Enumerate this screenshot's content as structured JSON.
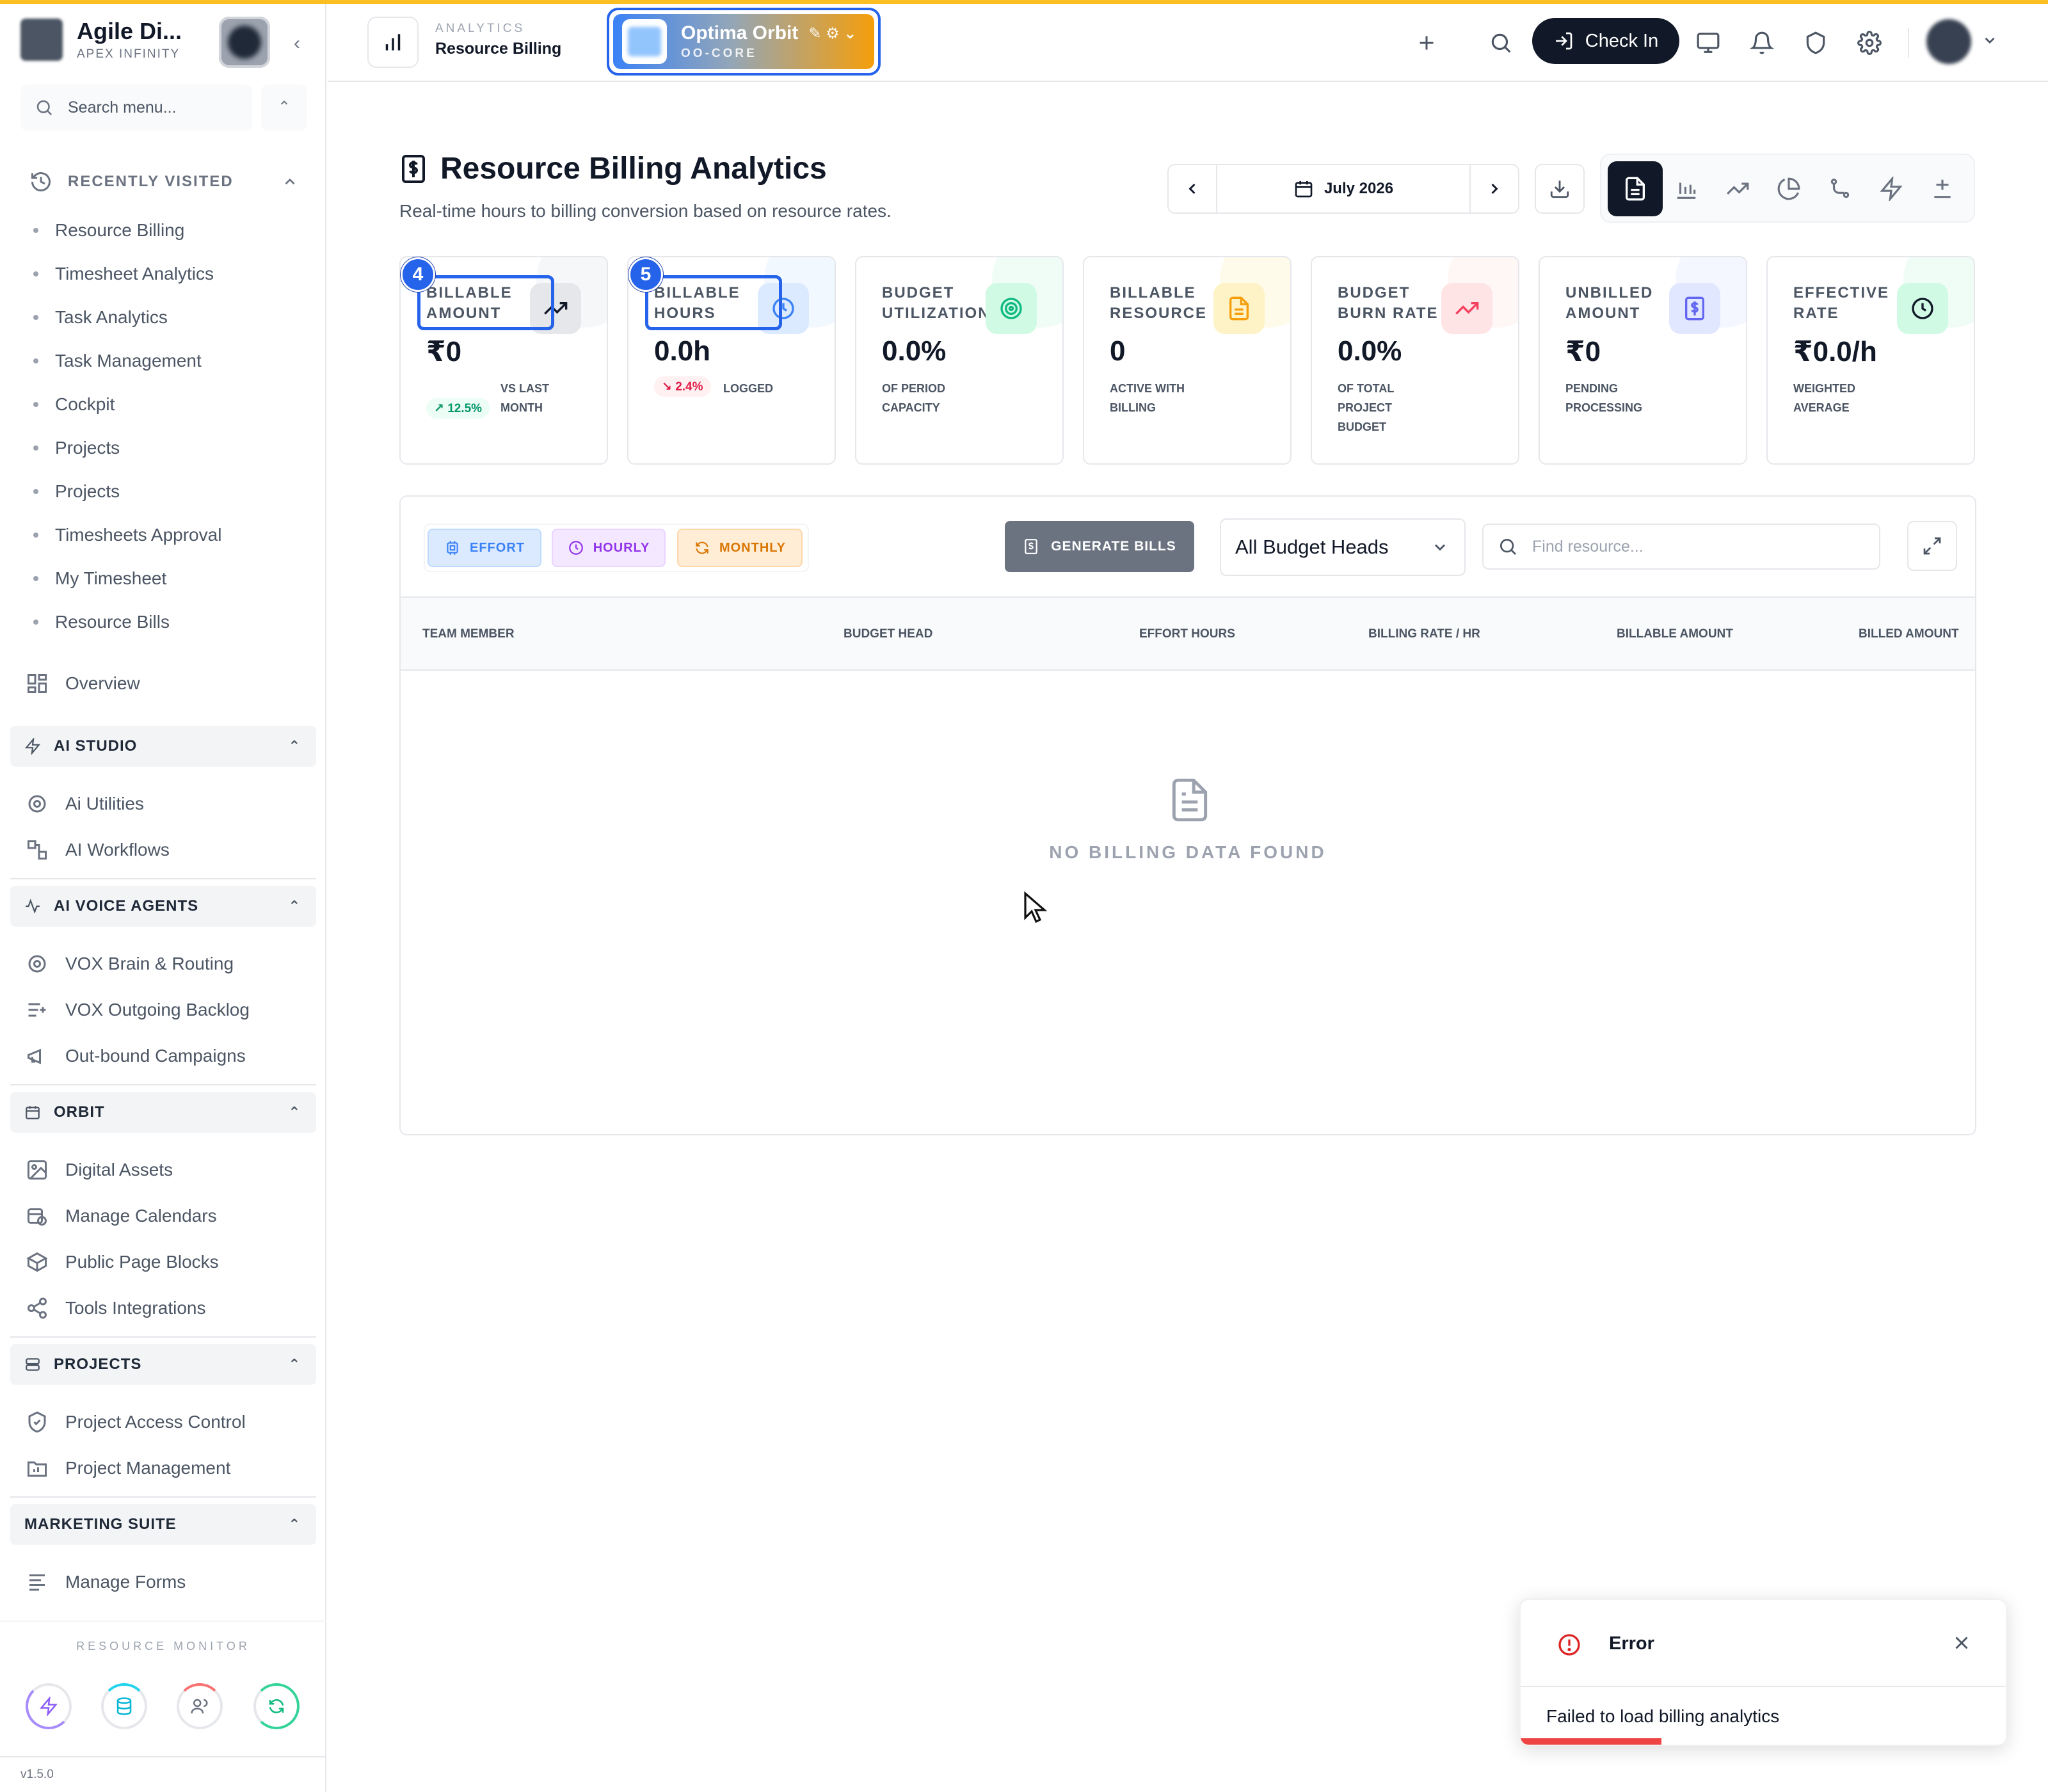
{
  "sidebar": {
    "brand_name": "Agile Di...",
    "brand_sub": "APEX INFINITY",
    "search_placeholder": "Search menu...",
    "recently_visited_title": "RECENTLY VISITED",
    "recent": [
      "Resource Billing",
      "Timesheet Analytics",
      "Task Analytics",
      "Task Management",
      "Cockpit",
      "Projects",
      "Projects",
      "Timesheets Approval",
      "My Timesheet",
      "Resource Bills"
    ],
    "overview": "Overview",
    "sections": [
      {
        "title": "AI STUDIO",
        "items": [
          "Ai Utilities",
          "AI Workflows"
        ]
      },
      {
        "title": "AI VOICE AGENTS",
        "items": [
          "VOX Brain & Routing",
          "VOX Outgoing Backlog",
          "Out-bound Campaigns"
        ]
      },
      {
        "title": "ORBIT",
        "items": [
          "Digital Assets",
          "Manage Calendars",
          "Public Page Blocks",
          "Tools Integrations"
        ]
      },
      {
        "title": "PROJECTS",
        "items": [
          "Project Access Control",
          "Project Management"
        ]
      },
      {
        "title": "MARKETING SUITE",
        "items": [
          "Manage Forms"
        ]
      }
    ],
    "resource_monitor": "RESOURCE MONITOR",
    "version": "v1.5.0"
  },
  "header": {
    "crumb_section": "ANALYTICS",
    "crumb_page": "Resource Billing",
    "org_name": "Optima Orbit",
    "org_code": "OO-CORE",
    "checkin_label": "Check In"
  },
  "page": {
    "title": "Resource Billing Analytics",
    "subtitle": "Real-time hours to billing conversion based on resource rates.",
    "month": "July 2026"
  },
  "kpis": [
    {
      "label": "BILLABLE AMOUNT",
      "value": "₹0",
      "trend": "↗ 12.5%",
      "trend_text": "VS LAST MONTH",
      "color": "#111827",
      "bg": "#e5e7eb"
    },
    {
      "label": "BILLABLE HOURS",
      "value": "0.0h",
      "trend": "↘ 2.4%",
      "trend_text": "LOGGED",
      "color": "#3b82f6",
      "bg": "#dbeafe"
    },
    {
      "label": "BUDGET UTILIZATION",
      "value": "0.0%",
      "sub": "OF PERIOD CAPACITY",
      "color": "#10b981",
      "bg": "#d1fae5"
    },
    {
      "label": "BILLABLE RESOURCE",
      "value": "0",
      "sub": "ACTIVE WITH BILLING",
      "color": "#f59e0b",
      "bg": "#fef3c7"
    },
    {
      "label": "BUDGET BURN RATE",
      "value": "0.0%",
      "sub": "OF TOTAL PROJECT BUDGET",
      "color": "#f43f5e",
      "bg": "#ffe4e6"
    },
    {
      "label": "UNBILLED AMOUNT",
      "value": "₹0",
      "sub": "PENDING PROCESSING",
      "color": "#6366f1",
      "bg": "#e0e7ff"
    },
    {
      "label": "EFFECTIVE RATE",
      "value": "₹0.0/h",
      "sub": "WEIGHTED AVERAGE",
      "color": "#111827",
      "bg": "#d1fae5"
    }
  ],
  "markers": [
    "4",
    "5"
  ],
  "filters": {
    "effort": "EFFORT",
    "hourly": "HOURLY",
    "monthly": "MONTHLY"
  },
  "generate_bills": "GENERATE BILLS",
  "budget_select": "All Budget Heads",
  "find_placeholder": "Find resource...",
  "table": {
    "columns": [
      "TEAM MEMBER",
      "BUDGET HEAD",
      "EFFORT HOURS",
      "BILLING RATE / HR",
      "BILLABLE AMOUNT",
      "BILLED AMOUNT"
    ],
    "empty": "NO BILLING DATA FOUND"
  },
  "toast": {
    "title": "Error",
    "message": "Failed to load billing analytics",
    "progress": 0.29
  },
  "colors": {
    "accent": "#2563eb",
    "top_strip": "#fbbf24",
    "error": "#dc2626"
  }
}
